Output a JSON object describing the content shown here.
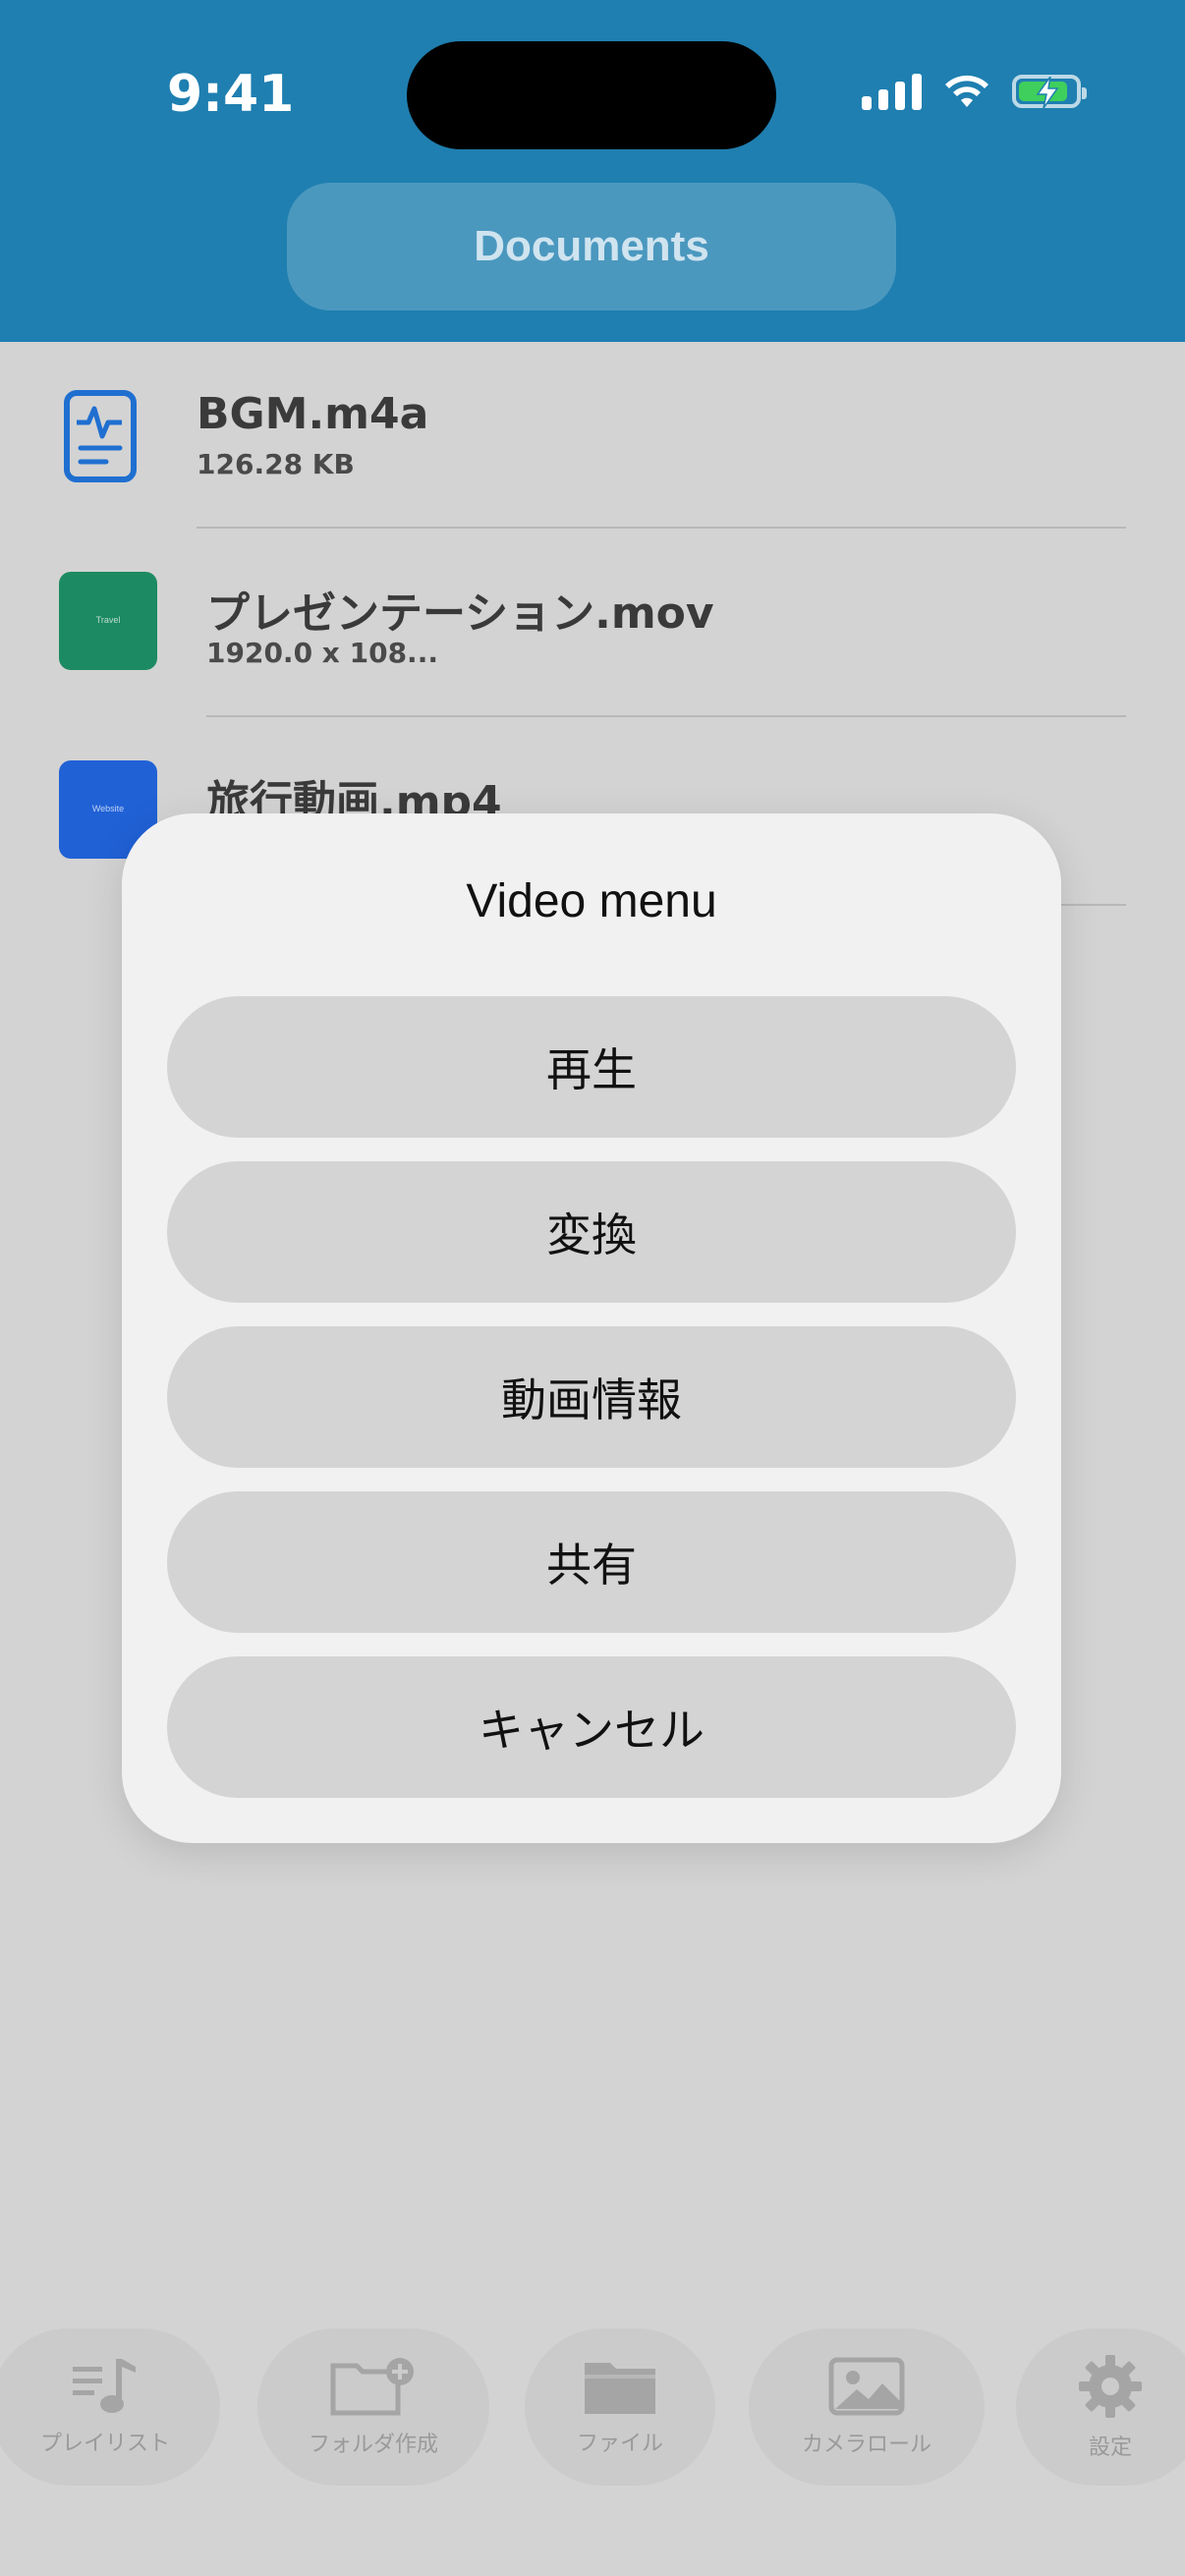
{
  "status_bar": {
    "time": "9:41"
  },
  "header": {
    "title": "Documents"
  },
  "files": [
    {
      "name": "BGM.m4a",
      "detail": "126.28 KB",
      "icon": "audio-document-icon"
    },
    {
      "name": "プレゼンテーション.mov",
      "detail": "1920.0 x 108...",
      "thumb_text": "Travel",
      "thumb_color": "#1c8a63"
    },
    {
      "name": "旅行動画.mp4",
      "detail": "",
      "thumb_text": "Website",
      "thumb_color": "#2061d6"
    }
  ],
  "modal": {
    "title": "Video menu",
    "buttons": [
      "再生",
      "変換",
      "動画情報",
      "共有",
      "キャンセル"
    ]
  },
  "tabbar": {
    "items": [
      {
        "label": "プレイリスト",
        "icon": "playlist-icon"
      },
      {
        "label": "フォルダ作成",
        "icon": "folder-add-icon"
      },
      {
        "label": "ファイル",
        "icon": "folder-icon"
      },
      {
        "label": "カメラロール",
        "icon": "photo-icon"
      },
      {
        "label": "設定",
        "icon": "gear-icon"
      }
    ]
  },
  "colors": {
    "header_bg": "#1f7fb0",
    "accent_blue": "#1f6fd0",
    "overlay_bg": "#d3d3d3"
  }
}
